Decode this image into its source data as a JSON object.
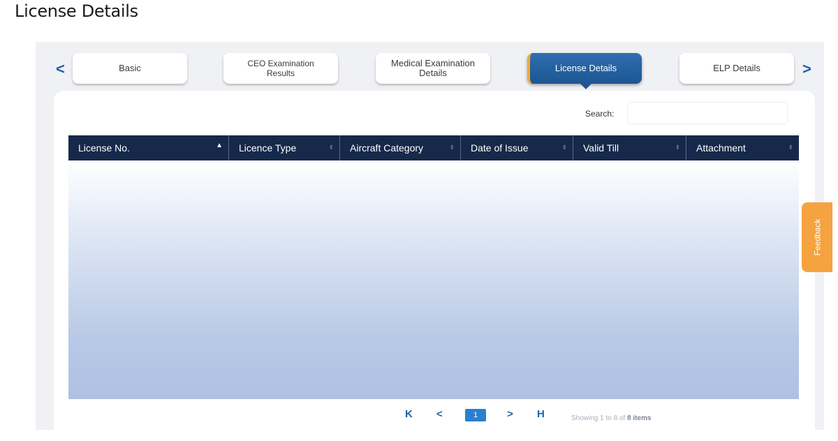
{
  "page": {
    "heading": "License Details"
  },
  "tabs": [
    {
      "line1": "Basic",
      "line2": ""
    },
    {
      "line1": "CEO Examination",
      "line2": "Results"
    },
    {
      "line1": "Medical Examination",
      "line2": "Details"
    },
    {
      "line1": "License Details",
      "line2": ""
    },
    {
      "line1": "ELP Details",
      "line2": ""
    }
  ],
  "active_tab": "License Details",
  "nav": {
    "prev_glyph": "<",
    "next_glyph": ">"
  },
  "search": {
    "label": "Search:",
    "value": "",
    "placeholder": ""
  },
  "table": {
    "columns": [
      "License No.",
      "Licence Type",
      "Aircraft Category",
      "Date of Issue",
      "Valid Till",
      "Attachment"
    ],
    "sorted_column": "License No.",
    "sort_direction": "ascending",
    "rows": []
  },
  "feedback": {
    "label": "Feedback"
  },
  "pagination": {
    "first_glyph": "K",
    "prev_glyph": "<",
    "current_page": "1",
    "next_glyph": ">",
    "last_glyph": "H",
    "showing_prefix": "Showing 1 to 8 of ",
    "showing_count": "8 items"
  },
  "colors": {
    "header_bg": "#16294a",
    "active_tab": "#1d5592",
    "accent_orange": "#f4a340",
    "link_blue": "#1f5fa8"
  }
}
